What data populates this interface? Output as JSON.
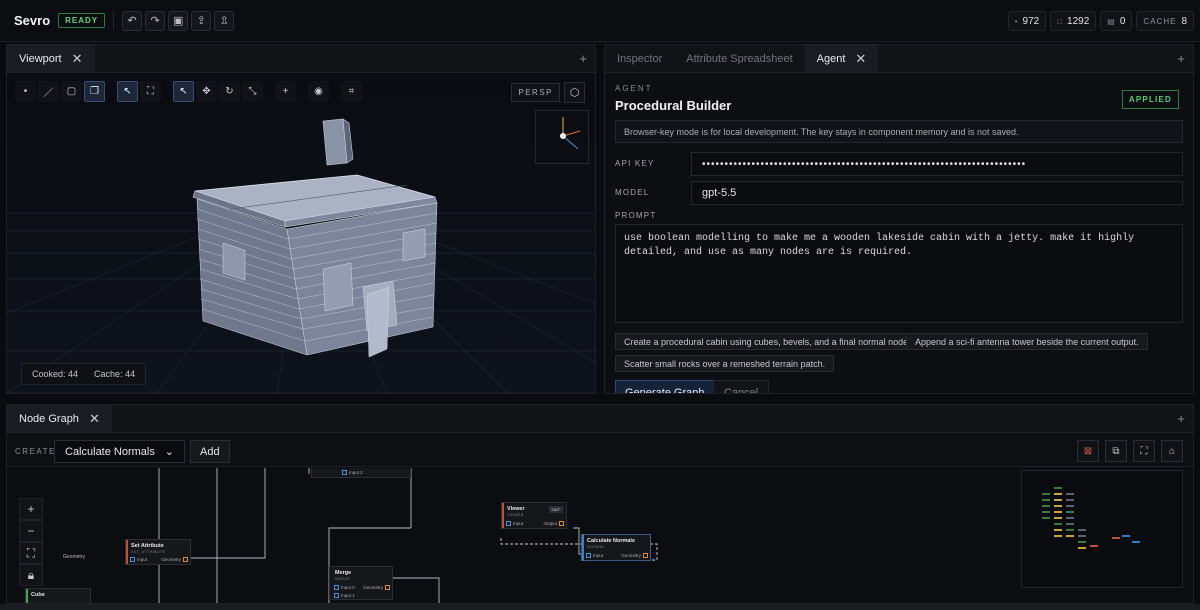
{
  "app": {
    "name": "Sevro",
    "status": "READY"
  },
  "topbar": {
    "tools": [
      {
        "icon": "undo-icon",
        "glyph": "↶"
      },
      {
        "icon": "redo-icon",
        "glyph": "↷"
      },
      {
        "icon": "save-icon",
        "glyph": "▣"
      },
      {
        "icon": "import-icon",
        "glyph": "⇪"
      },
      {
        "icon": "export-icon",
        "glyph": "⇫"
      }
    ],
    "stats": [
      {
        "icon": "points-icon",
        "glyph": "•",
        "value": "972"
      },
      {
        "icon": "primitives-icon",
        "glyph": "□",
        "value": "1292"
      },
      {
        "icon": "nodes-icon",
        "glyph": "▤",
        "value": "0"
      },
      {
        "label": "CACHE",
        "value": "8"
      }
    ]
  },
  "viewport": {
    "tab": "Viewport",
    "persp_label": "PERSP",
    "cooked": "Cooked: 44",
    "cache": "Cache: 44"
  },
  "agent_panel": {
    "tabs": [
      "Inspector",
      "Attribute Spreadsheet",
      "Agent"
    ],
    "eyebrow": "AGENT",
    "title": "Procedural Builder",
    "badge": "APPLIED",
    "info": "Browser-key mode is for local development. The key stays in component memory and is not saved.",
    "api_key_label": "API KEY",
    "api_key_value": "••••••••••••••••••••••••••••••••••••••••••••••••••••••••••••••••••••••••",
    "model_label": "MODEL",
    "model_value": "gpt-5.5",
    "prompt_label": "PROMPT",
    "prompt_value": "use boolean modelling to make me a wooden lakeside cabin with a jetty. make it highly detailed, and use as many nodes are is required.",
    "suggestions": [
      "Create a procedural cabin using cubes, bevels, and a final normal node.",
      "Append a sci-fi antenna tower beside the current output.",
      "Scatter small rocks over a remeshed terrain patch."
    ],
    "generate_label": "Generate Graph",
    "cancel_label": "Cancel"
  },
  "node_graph": {
    "tab": "Node Graph",
    "create_label": "CREATE",
    "selected_node_type": "Calculate Normals",
    "add_label": "Add",
    "nodes": {
      "set_attribute": {
        "title": "Set Attribute",
        "sub": "SET_ATTRIBUTE",
        "in": "Input",
        "out": "Geometry",
        "left_out": "Geometry"
      },
      "merge": {
        "title": "Merge",
        "sub": "MERGE",
        "in1": "Input 0",
        "in2": "Input 1",
        "out": "Geometry"
      },
      "viewer": {
        "title": "Viewer",
        "sub": "VIEWER",
        "badge": "OUT",
        "in": "Input",
        "out": "Output"
      },
      "calc_normals": {
        "title": "Calculate Normals",
        "sub": "NORMAL",
        "in": "Input",
        "out": "Geometry"
      },
      "top_node": {
        "in": "Input 2"
      },
      "cube": {
        "title": "Cube"
      }
    }
  },
  "colors": {
    "accent_blue": "#2c4a78",
    "ready_green": "#5fd47f",
    "port_out": "#e08a3c",
    "port_in": "#4d8fd8"
  }
}
